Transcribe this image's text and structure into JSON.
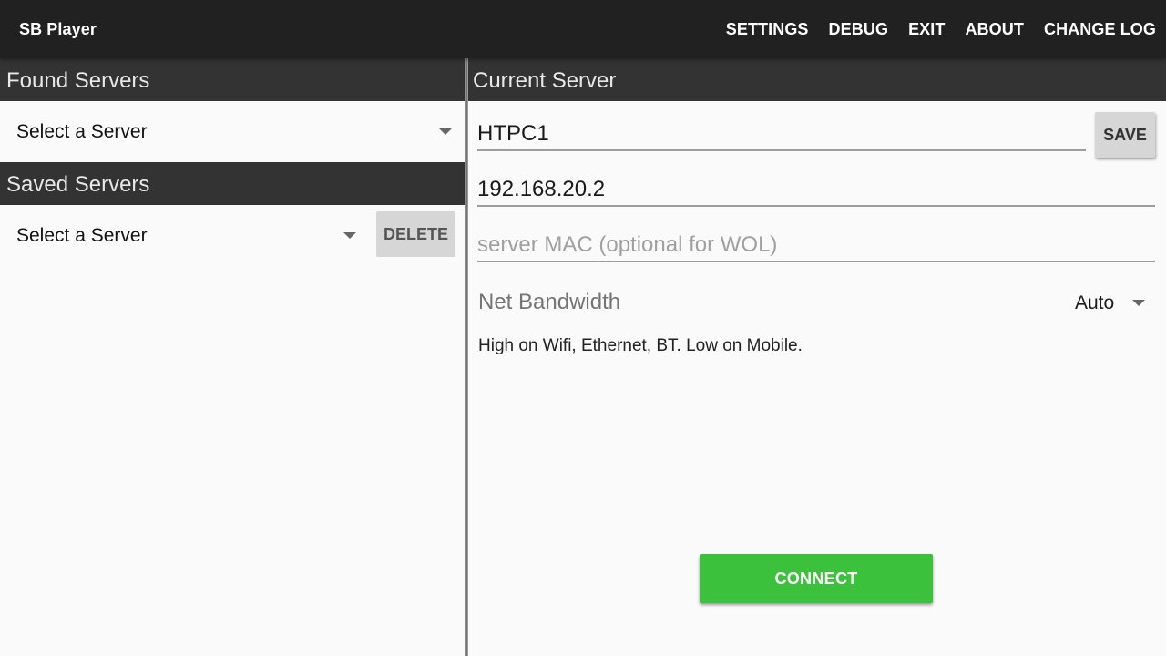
{
  "app": {
    "title": "SB Player"
  },
  "menu": {
    "items": [
      "SETTINGS",
      "DEBUG",
      "EXIT",
      "ABOUT",
      "CHANGE LOG"
    ]
  },
  "found_servers": {
    "header": "Found Servers",
    "spinner_value": "Select a Server"
  },
  "saved_servers": {
    "header": "Saved Servers",
    "spinner_value": "Select a Server",
    "delete_label": "DELETE"
  },
  "current_server": {
    "header": "Current Server",
    "name_value": "HTPC1",
    "save_label": "SAVE",
    "ip_value": "192.168.20.2",
    "mac_placeholder": "server MAC (optional for WOL)",
    "mac_value": "",
    "bandwidth_label": "Net Bandwidth",
    "bandwidth_value": "Auto",
    "bandwidth_hint": "High on Wifi, Ethernet, BT. Low on Mobile.",
    "connect_label": "CONNECT"
  },
  "colors": {
    "appbar": "#212121",
    "section_header": "#333333",
    "connect_button": "#3cc13c",
    "background": "#fafafa"
  },
  "icons": {
    "dropdown": "chevron-down-icon"
  }
}
